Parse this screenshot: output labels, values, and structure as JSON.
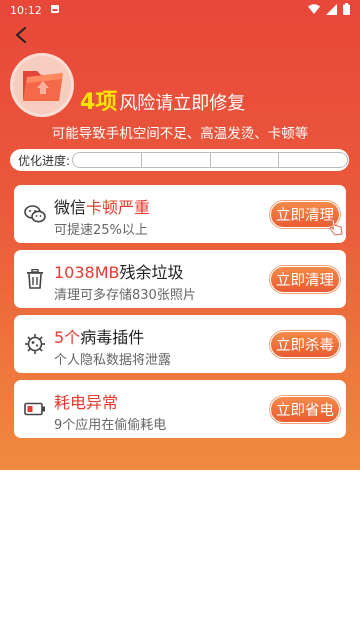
{
  "status": {
    "time": "10:12"
  },
  "hero": {
    "risk_count": "4项",
    "risk_text": "风险请立即修复",
    "subtitle": "可能导致手机空间不足、高温发烫、卡顿等"
  },
  "progress": {
    "label": "优化进度:",
    "segments": 4
  },
  "cards": [
    {
      "title_normal": "微信",
      "title_red": "卡顿严重",
      "subtitle": "可提速25%以上",
      "button": "立即清理",
      "icon": "wechat-icon"
    },
    {
      "title_red": "1038MB",
      "title_normal": "残余垃圾",
      "subtitle": "清理可多存储830张照片",
      "button": "立即清理",
      "icon": "trash-icon"
    },
    {
      "title_red": "5个",
      "title_normal": "病毒插件",
      "subtitle": "个人隐私数据将泄露",
      "button": "立即杀毒",
      "icon": "virus-icon"
    },
    {
      "title_red": "耗电异常",
      "subtitle": "9个应用在偷偷耗电",
      "button": "立即省电",
      "icon": "battery-icon"
    }
  ],
  "colors": {
    "accent_red": "#e63b2e",
    "highlight_yellow": "#ffe400",
    "button_orange": "#ea5b31"
  }
}
